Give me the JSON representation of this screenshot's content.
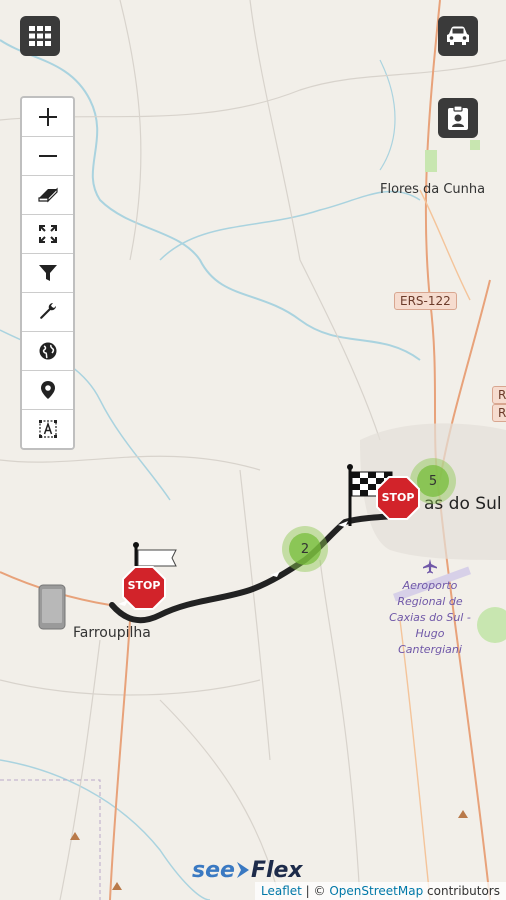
{
  "map": {
    "places": {
      "flores": "Flores da Cunha",
      "caxias": "as do Sul",
      "farroupilha": "Farroupilha"
    },
    "road_shields": {
      "ers122": "ERS-122",
      "rs_right": "RS",
      "rs_right2": "RS"
    },
    "airport": {
      "label": "Aeroporto Regional de Caxias do Sul - Hugo Cantergiani"
    },
    "clusters": {
      "cluster_a": "5",
      "cluster_b": "2"
    },
    "markers": {
      "start_stop": "STOP",
      "end_stop": "STOP"
    }
  },
  "toolbar": {
    "items": [
      "zoom-in",
      "zoom-out",
      "eraser",
      "fullscreen",
      "filter",
      "settings",
      "globe",
      "location",
      "label"
    ]
  },
  "attribution": {
    "leaflet": "Leaflet",
    "separator": " | © ",
    "osm": "OpenStreetMap",
    "contributors": " contributors"
  },
  "brand": {
    "see": "see",
    "flex": "Flex"
  },
  "colors": {
    "map_background": "#f2efe9",
    "route": "#222222",
    "water": "#aad3df",
    "main_road": "#e8a27a",
    "cluster": "#8cc850",
    "button_dark": "#3a3a3a"
  }
}
